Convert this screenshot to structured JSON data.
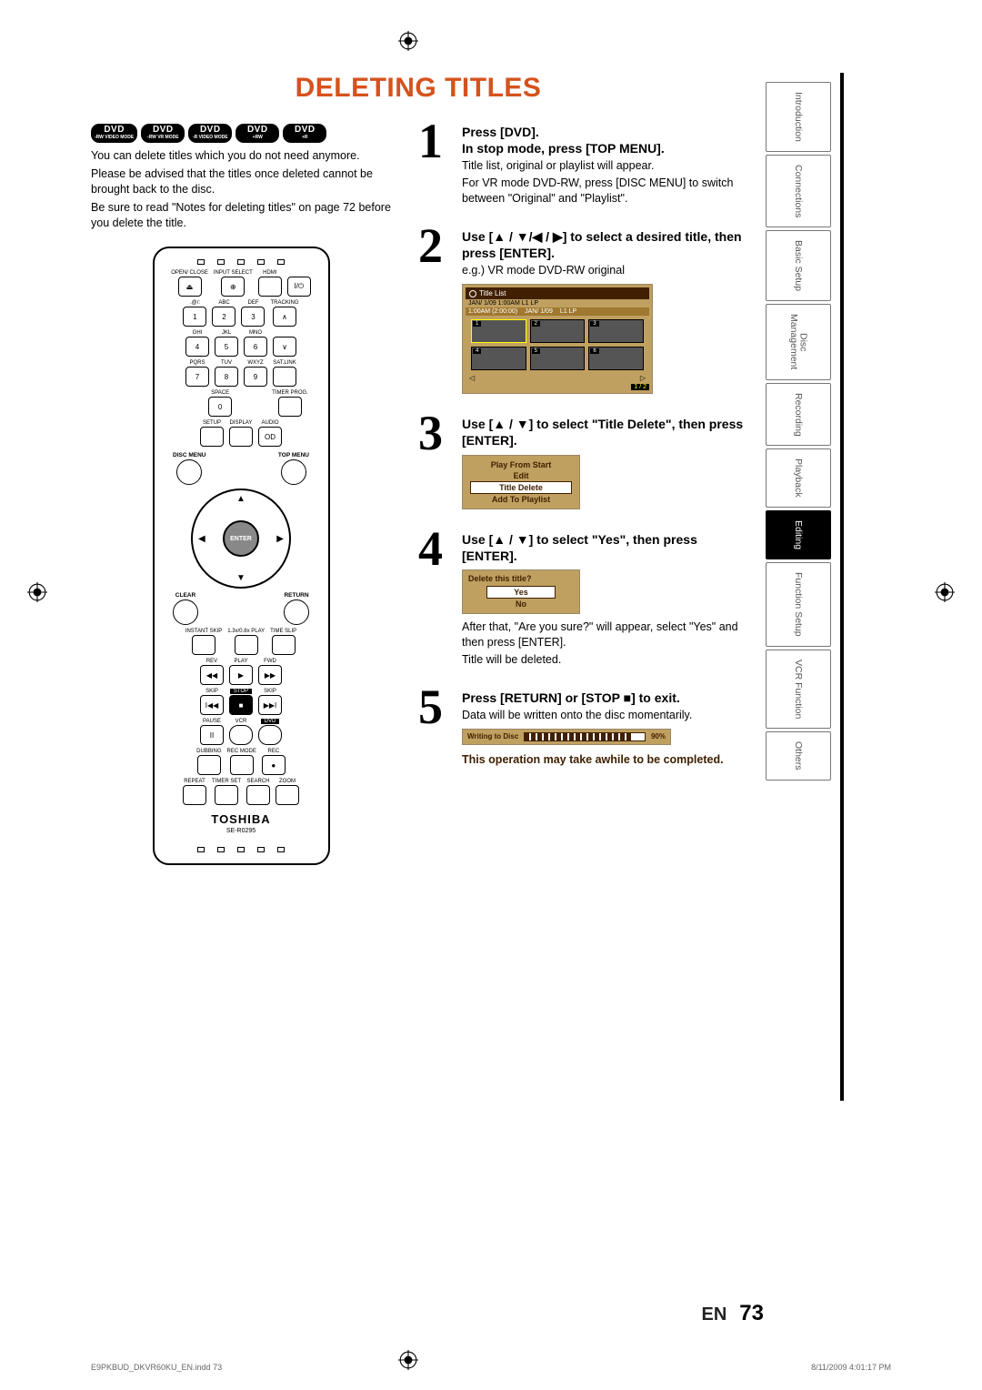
{
  "title": "DELETING TITLES",
  "badges": [
    {
      "main": "DVD",
      "sub": "-RW VIDEO MODE"
    },
    {
      "main": "DVD",
      "sub": "-RW VR MODE"
    },
    {
      "main": "DVD",
      "sub": "-R VIDEO MODE"
    },
    {
      "main": "DVD",
      "sub": "+RW"
    },
    {
      "main": "DVD",
      "sub": "+R"
    }
  ],
  "intro": {
    "p1": "You can delete titles which you do not need anymore.",
    "p2": "Please be advised that the titles once deleted cannot be brought back to the disc.",
    "p3": "Be sure to read \"Notes for deleting titles\" on page 72 before you delete the title."
  },
  "remote": {
    "brand": "TOSHIBA",
    "model": "SE-R0295",
    "labels": {
      "openclose": "OPEN/\nCLOSE",
      "inputselect": "INPUT\nSELECT",
      "hdmi": "HDMI",
      "abc": "ABC",
      "def": "DEF",
      "ghi": "GHI",
      "jkl": "JKL",
      "mno": "MNO",
      "pqrs": "PQRS",
      "tuv": "TUV",
      "wxyz": "WXYZ",
      "space": "SPACE",
      "tracking": "TRACKING",
      "satlink": "SAT.LINK",
      "timerprog": "TIMER\nPROG.",
      "setup": "SETUP",
      "display": "DISPLAY",
      "audio": "AUDIO",
      "discmenu": "DISC MENU",
      "topmenu": "TOP MENU",
      "clear": "CLEAR",
      "return": "RETURN",
      "enter": "ENTER",
      "instantskip": "INSTANT\nSKIP",
      "play13": "1.3x/0.8x\nPLAY",
      "timeslip": "TIME SLIP",
      "rev": "REV",
      "play": "PLAY",
      "fwd": "FWD",
      "skip": "SKIP",
      "stop": "STOP",
      "pause": "PAUSE",
      "vcr": "VCR",
      "dvd": "DVD",
      "dubbing": "DUBBING",
      "recmode": "REC MODE",
      "rec": "REC",
      "repeat": "REPEAT",
      "timerset": "TIMER SET",
      "search": "SEARCH",
      "zoom": "ZOOM",
      "sym": ".@/:"
    },
    "nums": {
      "k1": "1",
      "k2": "2",
      "k3": "3",
      "k4": "4",
      "k5": "5",
      "k6": "6",
      "k7": "7",
      "k8": "8",
      "k9": "9",
      "k0": "0"
    }
  },
  "steps": {
    "s1": {
      "num": "1",
      "h1": "Press [DVD].",
      "h2": "In stop mode, press [TOP MENU].",
      "b1": "Title list, original or playlist will appear.",
      "b2": "For VR mode DVD-RW, press [DISC MENU] to switch between \"Original\" and \"Playlist\"."
    },
    "s2": {
      "num": "2",
      "h1": "Use [▲ / ▼/◀ / ▶] to select a desired title, then press [ENTER].",
      "b1": "e.g.) VR mode DVD-RW original",
      "osd": {
        "title": "Title List",
        "date": "JAN/ 1/09 1:00AM  L1   LP",
        "selTime": "1:00AM (2:00:00)",
        "selDate": "JAN/ 1/09",
        "selExtra": "L1   LP",
        "page": "1 / 2",
        "thumbs": [
          "1",
          "2",
          "3",
          "4",
          "5",
          "6"
        ]
      }
    },
    "s3": {
      "num": "3",
      "h1": "Use [▲ / ▼] to select \"Title Delete\", then press [ENTER].",
      "menu": {
        "i1": "Play From Start",
        "i2": "Edit",
        "i3": "Title Delete",
        "i4": "Add To Playlist"
      }
    },
    "s4": {
      "num": "4",
      "h1": "Use [▲ / ▼] to select \"Yes\", then press [ENTER].",
      "confirm": {
        "q": "Delete this title?",
        "yes": "Yes",
        "no": "No"
      },
      "b1": "After that, \"Are you sure?\" will appear, select \"Yes\" and then press [ENTER].",
      "b2": "Title will be deleted."
    },
    "s5": {
      "num": "5",
      "h1": "Press [RETURN] or [STOP ■] to exit.",
      "b1": "Data will be written onto the disc momentarily.",
      "write": {
        "label": "Writing to Disc",
        "pct": "90%"
      },
      "note": "This operation may take awhile to be completed."
    }
  },
  "tabs": {
    "t1": "Introduction",
    "t2": "Connections",
    "t3": "Basic Setup",
    "t4a": "Disc",
    "t4b": "Management",
    "t5": "Recording",
    "t6": "Playback",
    "t7": "Editing",
    "t8": "Function Setup",
    "t9": "VCR Function",
    "t10": "Others"
  },
  "footer": {
    "lang": "EN",
    "num": "73"
  },
  "tinyfooter": {
    "file": "E9PKBUD_DKVR60KU_EN.indd   73",
    "ts": "8/11/2009   4:01:17 PM"
  }
}
